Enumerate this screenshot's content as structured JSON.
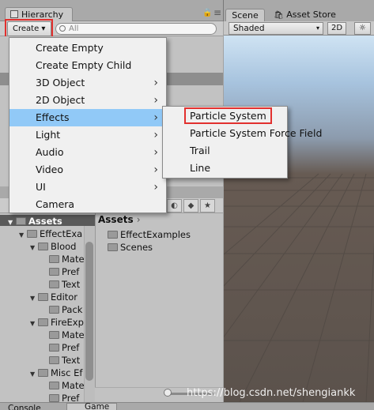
{
  "hierarchy": {
    "tab_label": "Hierarchy",
    "create_label": "Create ▾",
    "search_placeholder": "All"
  },
  "create_menu": [
    {
      "label": "Create Empty",
      "submenu": false
    },
    {
      "label": "Create Empty Child",
      "submenu": false
    },
    {
      "label": "3D Object",
      "submenu": true
    },
    {
      "label": "2D Object",
      "submenu": true
    },
    {
      "label": "Effects",
      "submenu": true,
      "active": true
    },
    {
      "label": "Light",
      "submenu": true
    },
    {
      "label": "Audio",
      "submenu": true
    },
    {
      "label": "Video",
      "submenu": true
    },
    {
      "label": "UI",
      "submenu": true
    },
    {
      "label": "Camera",
      "submenu": false
    }
  ],
  "effects_submenu": [
    {
      "label": "Particle System",
      "highlighted": true
    },
    {
      "label": "Particle System Force Field"
    },
    {
      "label": "Trail"
    },
    {
      "label": "Line"
    }
  ],
  "project": {
    "tree": [
      {
        "label": "Assets"
      },
      {
        "label": "EffectExa"
      },
      {
        "label": "Blood"
      },
      {
        "label": "Mate"
      },
      {
        "label": "Pref"
      },
      {
        "label": "Text"
      },
      {
        "label": "Editor"
      },
      {
        "label": "Pack"
      },
      {
        "label": "FireExp"
      },
      {
        "label": "Mate"
      },
      {
        "label": "Pref"
      },
      {
        "label": "Text"
      },
      {
        "label": "Misc Ef"
      },
      {
        "label": "Mate"
      },
      {
        "label": "Pref"
      }
    ],
    "breadcrumb": "Assets",
    "items": [
      "EffectExamples",
      "Scenes"
    ]
  },
  "scene": {
    "tab_scene": "Scene",
    "tab_asset_store": "Asset Store",
    "shading": "Shaded",
    "mode_2d": "2D",
    "light_icon": "☼"
  },
  "bottom_tabs": {
    "console": "Console",
    "game": "Game"
  },
  "watermark": "https://blog.csdn.net/shengiankk",
  "colors": {
    "menu_active": "#91c9f7",
    "annotation_red": "#e2302e"
  }
}
